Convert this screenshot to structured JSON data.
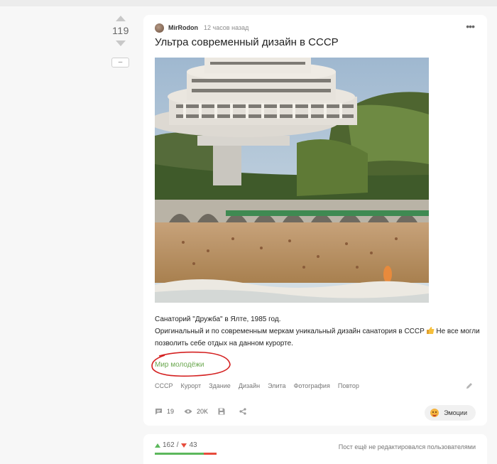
{
  "post": {
    "score": "119",
    "collapse_label": "–",
    "author": "MirRodon",
    "time": "12 часов назад",
    "menu_label": "•••",
    "title": "Ультра современный дизайн в СССР",
    "description_line1": "Санаторий \"Дружба\" в Ялте, 1985 год.",
    "description_line2a": "Оригинальный и по современным меркам уникальный дизайн санатория в СССР",
    "description_line2b": "Не все могли позволить себе отдых на данном курорте.",
    "community": "Мир молодёжи",
    "tags": [
      "СССР",
      "Курорт",
      "Здание",
      "Дизайн",
      "Элита",
      "Фотография",
      "Повтор"
    ],
    "comments_count": "19",
    "views_count": "20K",
    "emotions_label": "Эмоции"
  },
  "stats": {
    "upvotes": "162",
    "separator": "/",
    "downvotes": "43",
    "upvote_share": 0.79,
    "edit_note": "Пост ещё не редактировался пользователями"
  },
  "icons": {
    "vote_up": "triangle-up-icon",
    "vote_down": "triangle-down-icon",
    "comments": "speech-bubble-icon",
    "views": "eye-icon",
    "save": "floppy-disk-icon",
    "share": "share-icon",
    "edit": "pencil-icon",
    "thumbs_up": "thumbs-up-emoji-icon",
    "emotion": "emoji-face-icon"
  },
  "colors": {
    "community_link": "#6aa84f",
    "upvote": "#5cb85c",
    "downvote": "#e74c3c",
    "annotation_circle": "#d42020"
  }
}
